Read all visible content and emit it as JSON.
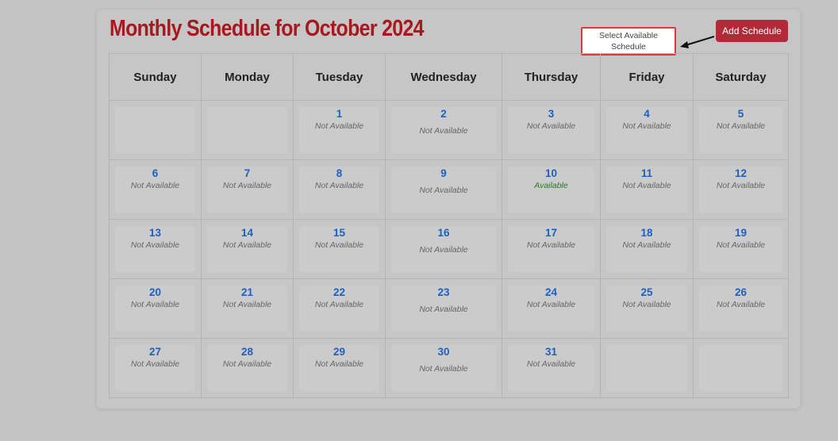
{
  "header": {
    "title": "Monthly Schedule for October 2024",
    "add_button_label": "Add Schedule",
    "callout_text": "Select Available Schedule"
  },
  "colors": {
    "title": "#a8191f",
    "button": "#b02a37",
    "day_number": "#1f5fbf",
    "available": "#2a7a2a",
    "not_available": "#666666",
    "callout_border": "#e03a40"
  },
  "calendar": {
    "weekdays": [
      "Sunday",
      "Monday",
      "Tuesday",
      "Wednesday",
      "Thursday",
      "Friday",
      "Saturday"
    ],
    "weeks": [
      [
        {
          "day": "",
          "status": ""
        },
        {
          "day": "",
          "status": ""
        },
        {
          "day": "1",
          "status": "Not Available"
        },
        {
          "day": "2",
          "status": "Not Available"
        },
        {
          "day": "3",
          "status": "Not Available"
        },
        {
          "day": "4",
          "status": "Not Available"
        },
        {
          "day": "5",
          "status": "Not Available"
        }
      ],
      [
        {
          "day": "6",
          "status": "Not Available"
        },
        {
          "day": "7",
          "status": "Not Available"
        },
        {
          "day": "8",
          "status": "Not Available"
        },
        {
          "day": "9",
          "status": "Not Available"
        },
        {
          "day": "10",
          "status": "Available"
        },
        {
          "day": "11",
          "status": "Not Available"
        },
        {
          "day": "12",
          "status": "Not Available"
        }
      ],
      [
        {
          "day": "13",
          "status": "Not Available"
        },
        {
          "day": "14",
          "status": "Not Available"
        },
        {
          "day": "15",
          "status": "Not Available"
        },
        {
          "day": "16",
          "status": "Not Available"
        },
        {
          "day": "17",
          "status": "Not Available"
        },
        {
          "day": "18",
          "status": "Not Available"
        },
        {
          "day": "19",
          "status": "Not Available"
        }
      ],
      [
        {
          "day": "20",
          "status": "Not Available"
        },
        {
          "day": "21",
          "status": "Not Available"
        },
        {
          "day": "22",
          "status": "Not Available"
        },
        {
          "day": "23",
          "status": "Not Available"
        },
        {
          "day": "24",
          "status": "Not Available"
        },
        {
          "day": "25",
          "status": "Not Available"
        },
        {
          "day": "26",
          "status": "Not Available"
        }
      ],
      [
        {
          "day": "27",
          "status": "Not Available"
        },
        {
          "day": "28",
          "status": "Not Available"
        },
        {
          "day": "29",
          "status": "Not Available"
        },
        {
          "day": "30",
          "status": "Not Available"
        },
        {
          "day": "31",
          "status": "Not Available"
        },
        {
          "day": "",
          "status": ""
        },
        {
          "day": "",
          "status": ""
        }
      ]
    ]
  }
}
